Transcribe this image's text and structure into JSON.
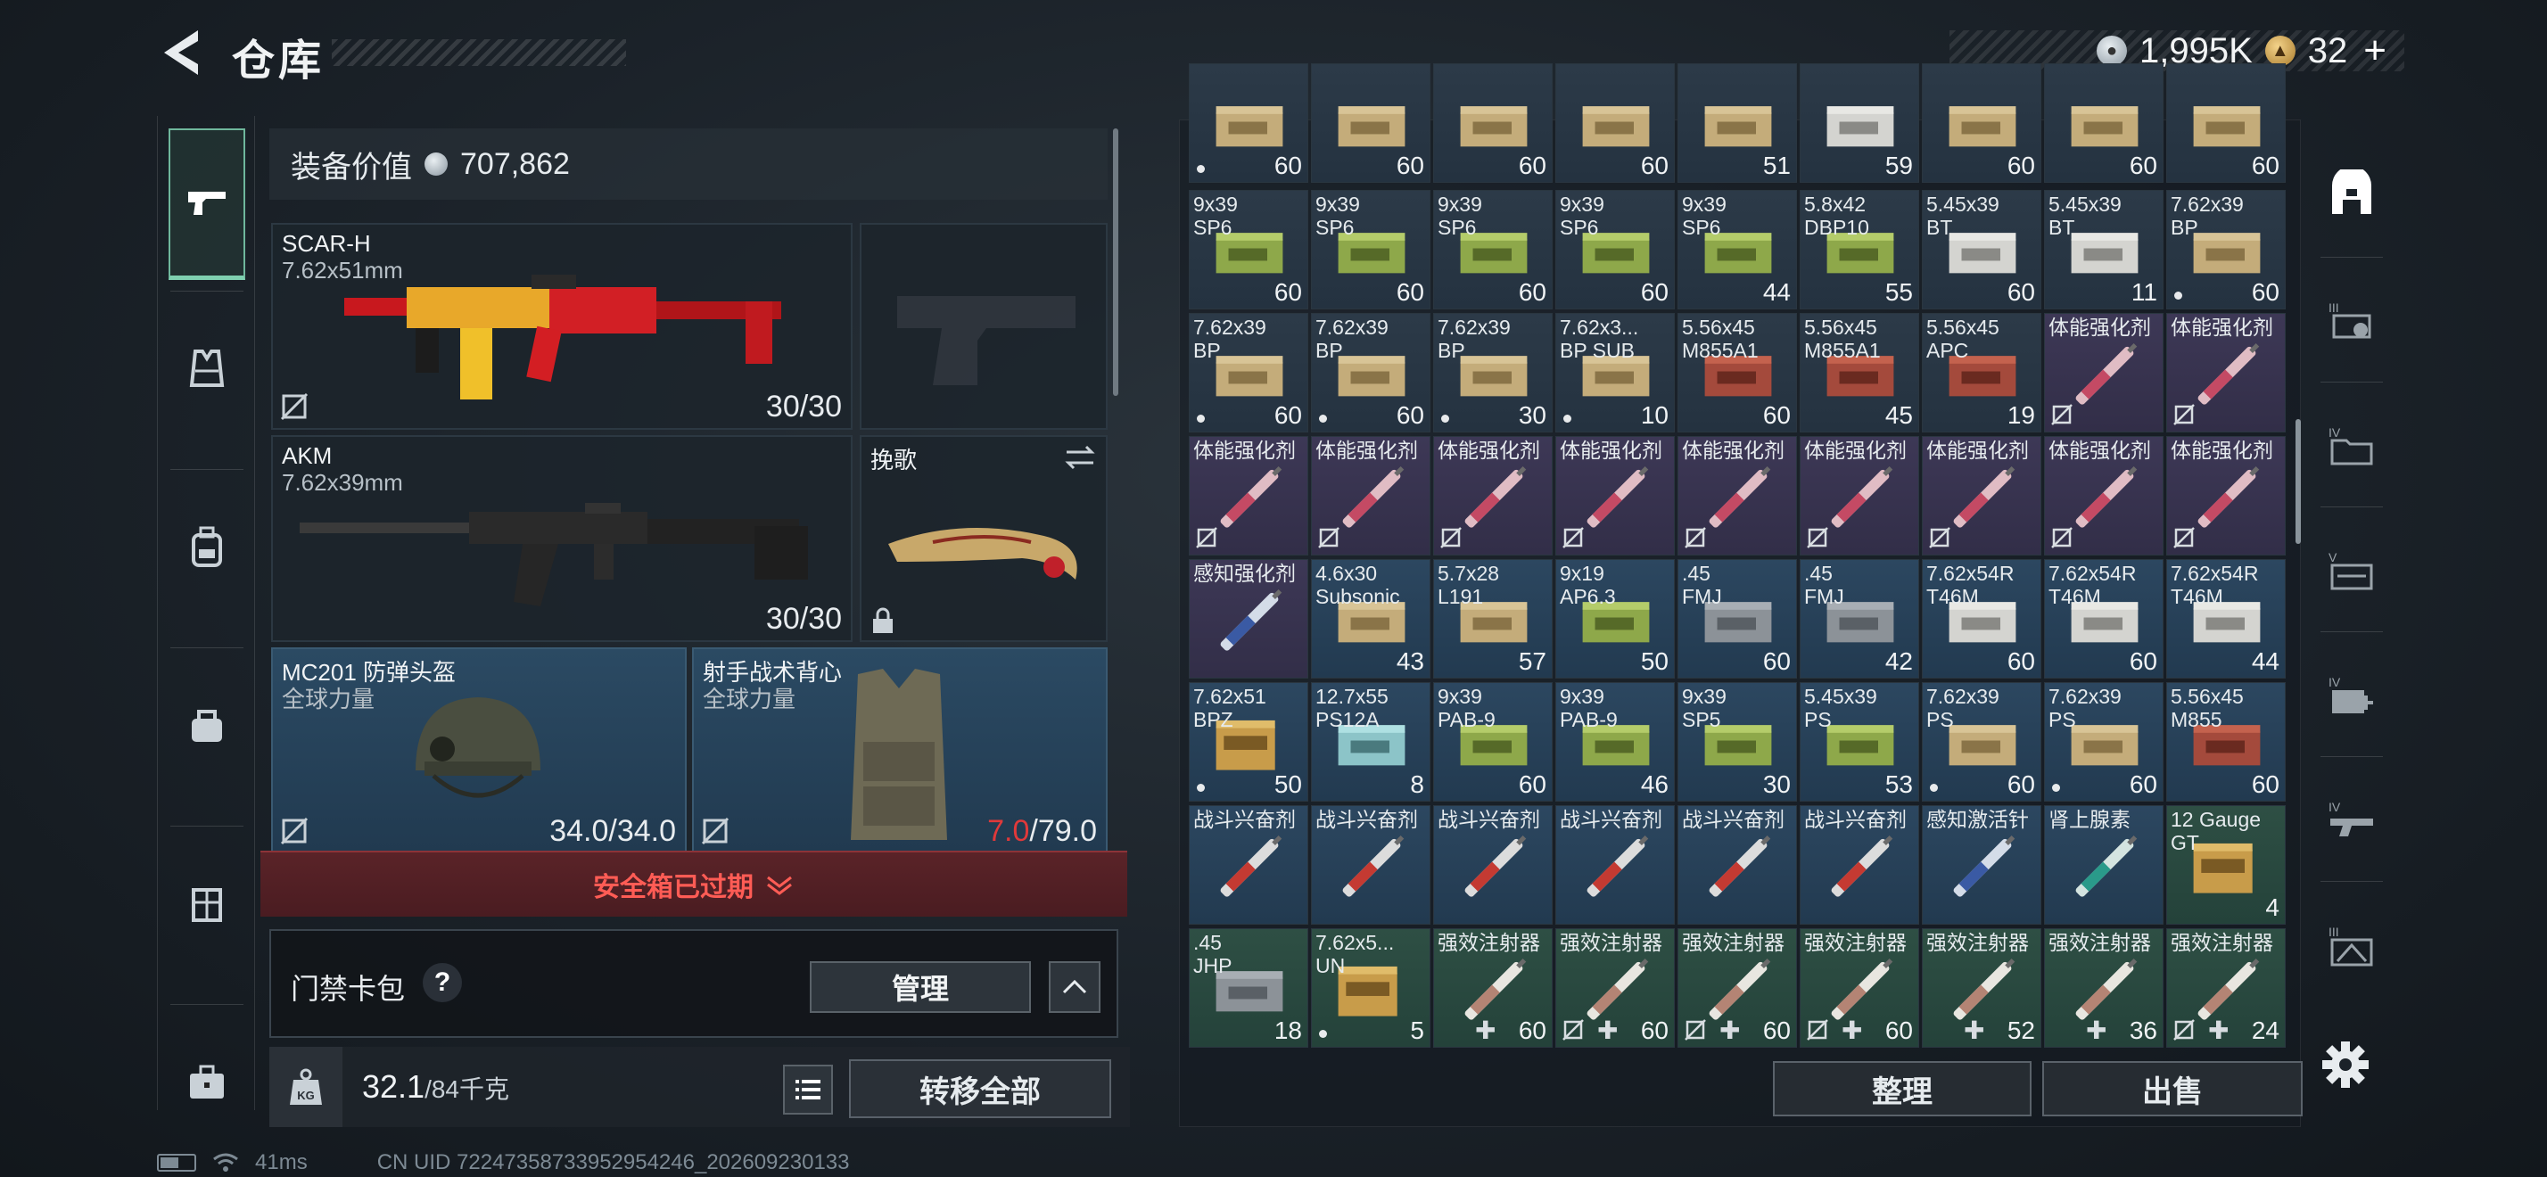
{
  "header": {
    "title": "仓库",
    "currency_silver": "1,995K",
    "currency_gold": "32",
    "plus": "+"
  },
  "equipment": {
    "value_label": "装备价值",
    "value": "707,862",
    "primary": {
      "name": "SCAR-H",
      "caliber": "7.62x51mm",
      "ammo": "30/30"
    },
    "secondary": {
      "name": "AKM",
      "caliber": "7.62x39mm",
      "ammo": "30/30"
    },
    "melee": {
      "name": "挽歌"
    },
    "helmet": {
      "name": "MC201 防弹头盔",
      "brand": "全球力量",
      "durability": "34.0/34.0"
    },
    "vest": {
      "name": "射手战术背心",
      "brand": "全球力量",
      "durability_current": "7.0",
      "durability_max": "/79.0"
    },
    "safe_box_status": "安全箱已过期",
    "keycard_label": "门禁卡包",
    "help": "?",
    "manage_label": "管理",
    "weight_current": "32.1",
    "weight_max": "/84千克",
    "weight_icon_text": "KG",
    "transfer_all_label": "转移全部"
  },
  "inventory": {
    "rows": [
      [
        {
          "name": "",
          "count": "60",
          "mark": "dot",
          "color": "c-dark",
          "art": "ammo-tan"
        },
        {
          "name": "",
          "count": "60",
          "mark": "",
          "color": "c-dark",
          "art": "ammo-tan"
        },
        {
          "name": "",
          "count": "60",
          "mark": "",
          "color": "c-dark",
          "art": "ammo-tan"
        },
        {
          "name": "",
          "count": "60",
          "mark": "",
          "color": "c-dark",
          "art": "ammo-tan"
        },
        {
          "name": "",
          "count": "51",
          "mark": "",
          "color": "c-dark",
          "art": "ammo-tan"
        },
        {
          "name": "",
          "count": "59",
          "mark": "",
          "color": "c-dark",
          "art": "ammo-white"
        },
        {
          "name": "",
          "count": "60",
          "mark": "",
          "color": "c-dark",
          "art": "ammo-tan"
        },
        {
          "name": "",
          "count": "60",
          "mark": "",
          "color": "c-dark",
          "art": "ammo-tan"
        },
        {
          "name": "",
          "count": "60",
          "mark": "",
          "color": "c-dark",
          "art": "ammo-tan"
        }
      ],
      [
        {
          "name": "9x39\nSP6",
          "count": "60",
          "mark": "",
          "color": "c-dark",
          "art": "ammo-green"
        },
        {
          "name": "9x39\nSP6",
          "count": "60",
          "mark": "",
          "color": "c-dark",
          "art": "ammo-green"
        },
        {
          "name": "9x39\nSP6",
          "count": "60",
          "mark": "",
          "color": "c-dark",
          "art": "ammo-green"
        },
        {
          "name": "9x39\nSP6",
          "count": "60",
          "mark": "",
          "color": "c-dark",
          "art": "ammo-green"
        },
        {
          "name": "9x39\nSP6",
          "count": "44",
          "mark": "",
          "color": "c-dark",
          "art": "ammo-green"
        },
        {
          "name": "5.8x42\nDBP10",
          "count": "55",
          "mark": "",
          "color": "c-dark",
          "art": "ammo-green"
        },
        {
          "name": "5.45x39\nBT",
          "count": "60",
          "mark": "",
          "color": "c-dark",
          "art": "ammo-white"
        },
        {
          "name": "5.45x39\nBT",
          "count": "11",
          "mark": "",
          "color": "c-dark",
          "art": "ammo-white"
        },
        {
          "name": "7.62x39\nBP",
          "count": "60",
          "mark": "dot",
          "color": "c-dark",
          "art": "ammo-tan"
        }
      ],
      [
        {
          "name": "7.62x39\nBP",
          "count": "60",
          "mark": "dot",
          "color": "c-dark",
          "art": "ammo-tan"
        },
        {
          "name": "7.62x39\nBP",
          "count": "60",
          "mark": "dot",
          "color": "c-dark",
          "art": "ammo-tan"
        },
        {
          "name": "7.62x39\nBP",
          "count": "30",
          "mark": "dot",
          "color": "c-dark",
          "art": "ammo-tan"
        },
        {
          "name": "7.62x3...\nBP SUB",
          "count": "10",
          "mark": "dot",
          "color": "c-dark",
          "art": "ammo-tan"
        },
        {
          "name": "5.56x45\nM855A1",
          "count": "60",
          "mark": "",
          "color": "c-dark",
          "art": "ammo-red"
        },
        {
          "name": "5.56x45\nM855A1",
          "count": "45",
          "mark": "",
          "color": "c-dark",
          "art": "ammo-red"
        },
        {
          "name": "5.56x45\nAPC",
          "count": "19",
          "mark": "",
          "color": "c-dark",
          "art": "ammo-red"
        },
        {
          "name": "体能强化剂",
          "count": "",
          "mark": "lock",
          "color": "c-purple",
          "art": "syringe-pink"
        },
        {
          "name": "体能强化剂",
          "count": "",
          "mark": "lock",
          "color": "c-purple",
          "art": "syringe-pink"
        }
      ],
      [
        {
          "name": "体能强化剂",
          "count": "",
          "mark": "lock",
          "color": "c-purple",
          "art": "syringe-pink"
        },
        {
          "name": "体能强化剂",
          "count": "",
          "mark": "lock",
          "color": "c-purple",
          "art": "syringe-pink"
        },
        {
          "name": "体能强化剂",
          "count": "",
          "mark": "lock",
          "color": "c-purple",
          "art": "syringe-pink"
        },
        {
          "name": "体能强化剂",
          "count": "",
          "mark": "lock",
          "color": "c-purple",
          "art": "syringe-pink"
        },
        {
          "name": "体能强化剂",
          "count": "",
          "mark": "lock",
          "color": "c-purple",
          "art": "syringe-pink"
        },
        {
          "name": "体能强化剂",
          "count": "",
          "mark": "lock",
          "color": "c-purple",
          "art": "syringe-pink"
        },
        {
          "name": "体能强化剂",
          "count": "",
          "mark": "lock",
          "color": "c-purple",
          "art": "syringe-pink"
        },
        {
          "name": "体能强化剂",
          "count": "",
          "mark": "lock",
          "color": "c-purple",
          "art": "syringe-pink"
        },
        {
          "name": "体能强化剂",
          "count": "",
          "mark": "lock",
          "color": "c-purple",
          "art": "syringe-pink"
        }
      ],
      [
        {
          "name": "感知强化剂",
          "count": "",
          "mark": "",
          "color": "c-purple",
          "art": "syringe-blue"
        },
        {
          "name": "4.6x30\nSubsonic",
          "count": "43",
          "mark": "",
          "color": "c-blue",
          "art": "ammo-tan"
        },
        {
          "name": "5.7x28\nL191",
          "count": "57",
          "mark": "",
          "color": "c-blue",
          "art": "ammo-tan"
        },
        {
          "name": "9x19\nAP6.3",
          "count": "50",
          "mark": "",
          "color": "c-blue",
          "art": "ammo-green"
        },
        {
          "name": ".45\nFMJ",
          "count": "60",
          "mark": "",
          "color": "c-blue",
          "art": "ammo-grey"
        },
        {
          "name": ".45\nFMJ",
          "count": "42",
          "mark": "",
          "color": "c-blue",
          "art": "ammo-grey"
        },
        {
          "name": "7.62x54R\nT46M",
          "count": "60",
          "mark": "",
          "color": "c-blue",
          "art": "ammo-white"
        },
        {
          "name": "7.62x54R\nT46M",
          "count": "60",
          "mark": "",
          "color": "c-blue",
          "art": "ammo-white"
        },
        {
          "name": "7.62x54R\nT46M",
          "count": "44",
          "mark": "",
          "color": "c-blue",
          "art": "ammo-white"
        }
      ],
      [
        {
          "name": "7.62x51\nBPZ",
          "count": "50",
          "mark": "dot",
          "color": "c-blue",
          "art": "ammo-gold"
        },
        {
          "name": "12.7x55\nPS12A",
          "count": "8",
          "mark": "",
          "color": "c-blue",
          "art": "ammo-cyan"
        },
        {
          "name": "9x39\nPAB-9",
          "count": "60",
          "mark": "",
          "color": "c-blue",
          "art": "ammo-green"
        },
        {
          "name": "9x39\nPAB-9",
          "count": "46",
          "mark": "",
          "color": "c-blue",
          "art": "ammo-green"
        },
        {
          "name": "9x39\nSP5",
          "count": "30",
          "mark": "",
          "color": "c-blue",
          "art": "ammo-green"
        },
        {
          "name": "5.45x39\nPS",
          "count": "53",
          "mark": "",
          "color": "c-blue",
          "art": "ammo-green"
        },
        {
          "name": "7.62x39\nPS",
          "count": "60",
          "mark": "dot",
          "color": "c-blue",
          "art": "ammo-tan"
        },
        {
          "name": "7.62x39\nPS",
          "count": "60",
          "mark": "dot",
          "color": "c-blue",
          "art": "ammo-tan"
        },
        {
          "name": "5.56x45\nM855",
          "count": "60",
          "mark": "",
          "color": "c-blue",
          "art": "ammo-red"
        }
      ],
      [
        {
          "name": "战斗兴奋剂",
          "count": "",
          "mark": "",
          "color": "c-blue",
          "art": "syringe-red"
        },
        {
          "name": "战斗兴奋剂",
          "count": "",
          "mark": "",
          "color": "c-blue",
          "art": "syringe-red"
        },
        {
          "name": "战斗兴奋剂",
          "count": "",
          "mark": "",
          "color": "c-blue",
          "art": "syringe-red"
        },
        {
          "name": "战斗兴奋剂",
          "count": "",
          "mark": "",
          "color": "c-blue",
          "art": "syringe-red"
        },
        {
          "name": "战斗兴奋剂",
          "count": "",
          "mark": "",
          "color": "c-blue",
          "art": "syringe-red"
        },
        {
          "name": "战斗兴奋剂",
          "count": "",
          "mark": "",
          "color": "c-blue",
          "art": "syringe-red"
        },
        {
          "name": "感知激活针",
          "count": "",
          "mark": "",
          "color": "c-blue",
          "art": "syringe-blue"
        },
        {
          "name": "肾上腺素",
          "count": "",
          "mark": "",
          "color": "c-blue",
          "art": "syringe-teal"
        },
        {
          "name": "12 Gauge\nGT",
          "count": "4",
          "mark": "",
          "color": "c-green",
          "art": "ammo-gold"
        }
      ],
      [
        {
          "name": ".45\nJHP",
          "count": "18",
          "mark": "",
          "color": "c-green",
          "art": "ammo-grey"
        },
        {
          "name": "7.62x5...\nUN",
          "count": "5",
          "mark": "dot",
          "color": "c-green",
          "art": "ammo-gold"
        },
        {
          "name": "强效注射器",
          "count": "60",
          "mark": "plus",
          "color": "c-green",
          "art": "syringe-white"
        },
        {
          "name": "强效注射器",
          "count": "60",
          "mark": "lockplus",
          "color": "c-green",
          "art": "syringe-white"
        },
        {
          "name": "强效注射器",
          "count": "60",
          "mark": "lockplus",
          "color": "c-green",
          "art": "syringe-white"
        },
        {
          "name": "强效注射器",
          "count": "60",
          "mark": "lockplus",
          "color": "c-green",
          "art": "syringe-white"
        },
        {
          "name": "强效注射器",
          "count": "52",
          "mark": "plus",
          "color": "c-green",
          "art": "syringe-white"
        },
        {
          "name": "强效注射器",
          "count": "36",
          "mark": "plus",
          "color": "c-green",
          "art": "syringe-white"
        },
        {
          "name": "强效注射器",
          "count": "24",
          "mark": "lockplus",
          "color": "c-green",
          "art": "syringe-white"
        }
      ]
    ],
    "sort_label": "整理",
    "sell_label": "出售"
  },
  "status": {
    "ping": "41ms",
    "uid": "CN UID 72247358733952954246_202609230133"
  }
}
